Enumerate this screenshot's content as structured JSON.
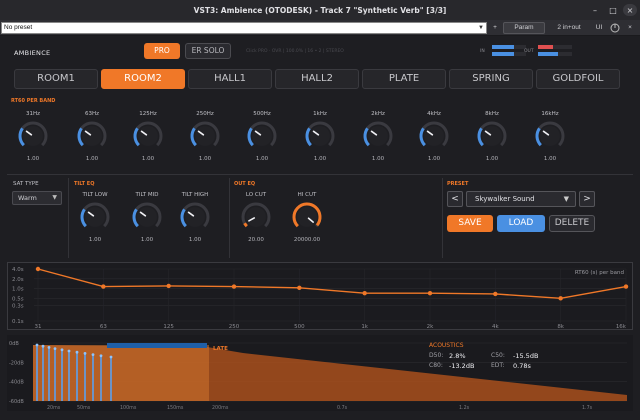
{
  "window": {
    "title": "VST3: Ambience (OTODESK) - Track 7 \"Synthetic Verb\" [3/3]",
    "minimize_glyph": "–",
    "maximize_glyph": "□",
    "close_glyph": "×"
  },
  "host": {
    "preset_value": "No preset",
    "plus_label": "+",
    "param_label": "Param",
    "io_label": "2 in+out",
    "ui_label": "UI",
    "close_label": "×"
  },
  "plugin": {
    "name": "AMBIENCE",
    "pro_label": "PRO",
    "er_solo_label": "ER SOLO",
    "info_text": "Click PRO · OVR | 100.0% | 16 • 2 | STEREO",
    "in_label": "IN",
    "out_label": "OUT",
    "in_levels": [
      0.65,
      0.65
    ],
    "out_levels": [
      0.45,
      0.6
    ],
    "accent": "#f07828",
    "blue": "#4a90e2"
  },
  "tabs": [
    {
      "label": "ROOM1",
      "active": false
    },
    {
      "label": "ROOM2",
      "active": true
    },
    {
      "label": "HALL1",
      "active": false
    },
    {
      "label": "HALL2",
      "active": false
    },
    {
      "label": "PLATE",
      "active": false
    },
    {
      "label": "SPRING",
      "active": false
    },
    {
      "label": "GOLDFOIL",
      "active": false
    }
  ],
  "rt60": {
    "title": "RT60 PER BAND",
    "bands": [
      {
        "label": "31Hz",
        "value": "1.00"
      },
      {
        "label": "63Hz",
        "value": "1.00"
      },
      {
        "label": "125Hz",
        "value": "1.00"
      },
      {
        "label": "250Hz",
        "value": "1.00"
      },
      {
        "label": "500Hz",
        "value": "1.00"
      },
      {
        "label": "1kHz",
        "value": "1.00"
      },
      {
        "label": "2kHz",
        "value": "1.00"
      },
      {
        "label": "4kHz",
        "value": "1.00"
      },
      {
        "label": "8kHz",
        "value": "1.00"
      },
      {
        "label": "16kHz",
        "value": "1.00"
      }
    ]
  },
  "sat": {
    "label": "SAT TYPE",
    "value": "Warm"
  },
  "tilt_eq": {
    "title": "TILT EQ",
    "knobs": [
      {
        "label": "TILT LOW",
        "value": "1.00"
      },
      {
        "label": "TILT MID",
        "value": "1.00"
      },
      {
        "label": "TILT HIGH",
        "value": "1.00"
      }
    ]
  },
  "out_eq": {
    "title": "OUT EQ",
    "knobs": [
      {
        "label": "LO CUT",
        "value": "20.00"
      },
      {
        "label": "HI CUT",
        "value": "20000.00"
      }
    ]
  },
  "preset": {
    "title": "PRESET",
    "prev_label": "<",
    "next_label": ">",
    "value": "Skywalker Sound",
    "save_label": "SAVE",
    "load_label": "LOAD",
    "delete_label": "DELETE"
  },
  "chart_data": [
    {
      "type": "line",
      "title": "RT60 (s) per band",
      "x": [
        "31",
        "63",
        "125",
        "250",
        "500",
        "1k",
        "2k",
        "4k",
        "8k",
        "16k"
      ],
      "y_ticks": [
        "4.0s",
        "2.0s",
        "1.0s",
        "0.5s",
        "0.3s",
        "0.1s"
      ],
      "series": [
        {
          "values": [
            4.0,
            1.15,
            1.2,
            1.15,
            1.05,
            0.72,
            0.72,
            0.68,
            0.5,
            1.15
          ]
        }
      ]
    },
    {
      "type": "area",
      "title": "",
      "late_label": "LATE",
      "y_ticks": [
        "0dB",
        "-20dB",
        "-40dB",
        "-60dB"
      ],
      "x_ticks": [
        "20ms",
        "50ms",
        "100ms",
        "150ms",
        "200ms",
        "0.7s",
        "1.2s",
        "1.7s"
      ]
    }
  ],
  "acoustics": {
    "title": "ACOUSTICS",
    "items": [
      {
        "key": "D50:",
        "value": "2.8%"
      },
      {
        "key": "C50:",
        "value": "-15.5dB"
      },
      {
        "key": "C80:",
        "value": "-13.2dB"
      },
      {
        "key": "EDT:",
        "value": "0.78s"
      }
    ]
  }
}
